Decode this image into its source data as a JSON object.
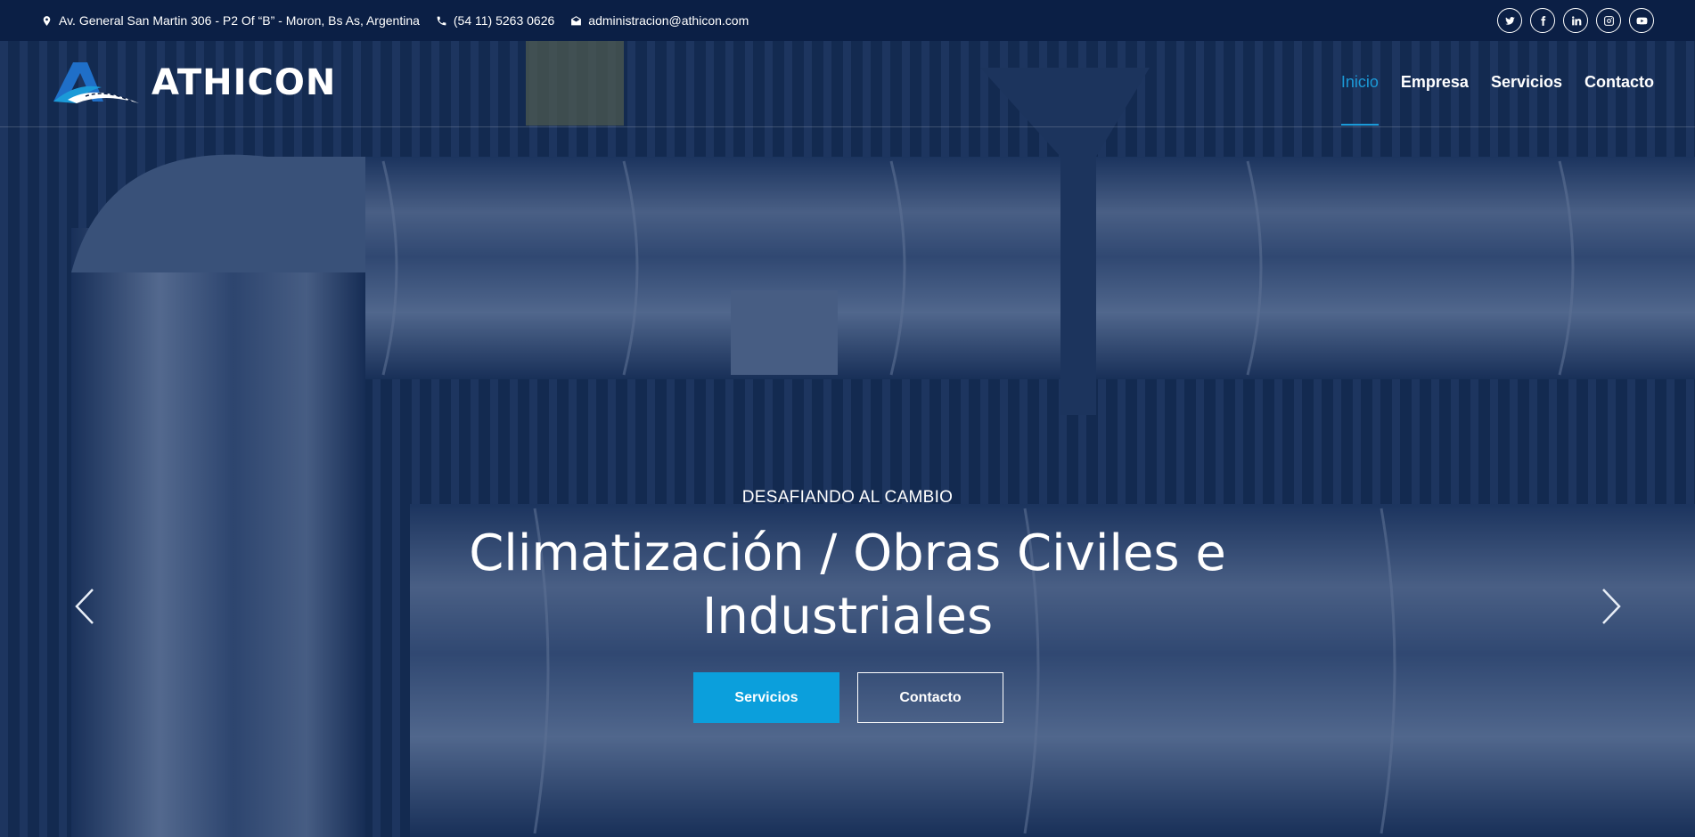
{
  "topbar": {
    "address": "Av. General San Martin 306 - P2 Of “B” - Moron, Bs As, Argentina",
    "phone": "(54 11) 5263 0626",
    "email": "administracion@athicon.com",
    "social_icons": [
      "twitter-icon",
      "facebook-icon",
      "linkedin-icon",
      "instagram-icon",
      "youtube-icon"
    ]
  },
  "brand": {
    "name": "ATHICON"
  },
  "nav": {
    "items": [
      {
        "label": "Inicio",
        "active": true
      },
      {
        "label": "Empresa"
      },
      {
        "label": "Servicios"
      },
      {
        "label": "Contacto"
      }
    ]
  },
  "hero": {
    "subtitle": "DESAFIANDO AL CAMBIO",
    "title_line1": "Climatización / Obras Civiles e",
    "title_line2": "Industriales",
    "primary_button": "Servicios",
    "secondary_button": "Contacto"
  },
  "colors": {
    "accent": "#0b9fdc",
    "topbar": "#0b1f45",
    "nav_active": "#1b9ad8"
  }
}
